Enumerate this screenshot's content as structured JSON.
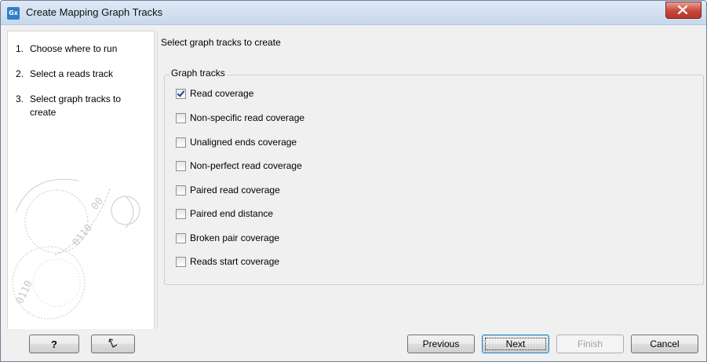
{
  "window": {
    "title": "Create Mapping Graph Tracks",
    "icon_label": "Gx"
  },
  "steps": [
    {
      "num": "1.",
      "label": "Choose where to run"
    },
    {
      "num": "2.",
      "label": "Select a reads track"
    },
    {
      "num": "3.",
      "label": "Select graph tracks to create"
    }
  ],
  "main": {
    "instruction": "Select graph tracks to create",
    "group_label": "Graph tracks",
    "tracks": [
      {
        "label": "Read coverage",
        "checked": true
      },
      {
        "label": "Non-specific read coverage",
        "checked": false
      },
      {
        "label": "Unaligned ends coverage",
        "checked": false
      },
      {
        "label": "Non-perfect read coverage",
        "checked": false
      },
      {
        "label": "Paired read coverage",
        "checked": false
      },
      {
        "label": "Paired end distance",
        "checked": false
      },
      {
        "label": "Broken pair coverage",
        "checked": false
      },
      {
        "label": "Reads start coverage",
        "checked": false
      }
    ]
  },
  "footer": {
    "help_label": "?",
    "previous_label": "Previous",
    "next_label": "Next",
    "finish_label": "Finish",
    "cancel_label": "Cancel"
  }
}
